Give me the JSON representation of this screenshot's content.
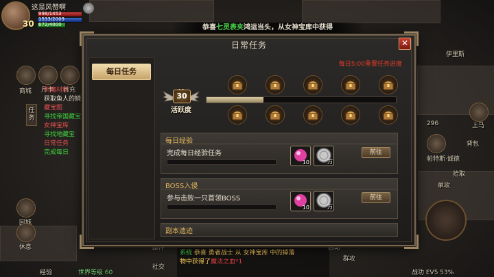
{
  "player": {
    "name": "这是风赞啊",
    "level": "30",
    "hp_text": "998/1453",
    "mp_text": "1533/2009",
    "xp_text": "672/4000"
  },
  "announcement": {
    "prefix": "恭喜",
    "highlight": "七灵表夹",
    "suffix": "鸿运当头，从女神宝库中获得"
  },
  "left_menu": {
    "items": [
      "商城",
      "月卡",
      "首充"
    ],
    "side_label": "任务",
    "bottom_items": [
      "回城",
      "休息"
    ]
  },
  "quest_tracker": [
    {
      "text": "附魔材料",
      "tone": "red"
    },
    {
      "text": "获取鱼人的鳞",
      "tone": "white"
    },
    {
      "text": "藏宝图",
      "tone": "red"
    },
    {
      "text": "寻找帝国藏宝",
      "tone": "green"
    },
    {
      "text": "女神宝库",
      "tone": "red"
    },
    {
      "text": "寻找地藏宝",
      "tone": "green"
    },
    {
      "text": "日常任务",
      "tone": "red"
    },
    {
      "text": "完成每日",
      "tone": "green"
    }
  ],
  "right_hud": {
    "location": "伊里斯",
    "coords": "296",
    "top_label": "上马",
    "right_labels": [
      "背包",
      "帕特斯·诚德",
      "拾取",
      "单攻"
    ]
  },
  "chat": {
    "lines": [
      {
        "prefix": "",
        "text": "中获得了",
        "item": "魔法之血*1"
      },
      {
        "prefix": "系统",
        "text": "恭喜 勇者战士 从 女神宝库 中的掉落",
        "item": ""
      },
      {
        "prefix": "",
        "text": "物中获得了",
        "item": "魔法之血*1"
      }
    ],
    "labels": [
      "邮件",
      "社交",
      "自动",
      "群攻"
    ]
  },
  "bottom_bar": {
    "exp_label": "经验",
    "extra": "世界等级 60",
    "combat_power": "战功 EV5 53%"
  },
  "dialog": {
    "title": "日常任务",
    "close_symbol": "✕",
    "tabs": [
      {
        "label": "每日任务",
        "selected": true
      }
    ],
    "reset_note": "每日5:00重置任务进度",
    "activity": {
      "value": "30",
      "label": "活跃度",
      "progress": 0.3
    },
    "tasks": [
      {
        "title": "每日经验",
        "description": "完成每日经验任务",
        "progress": 0,
        "rewards": [
          {
            "name": "magic-gem",
            "qty": "10"
          },
          {
            "name": "silver-coin",
            "qty": "万"
          }
        ],
        "button": "前往"
      },
      {
        "title": "BOSS入侵",
        "description": "参与击败一只首领BOSS",
        "progress": 0,
        "rewards": [
          {
            "name": "magic-gem",
            "qty": "10"
          },
          {
            "name": "silver-coin",
            "qty": "万"
          }
        ],
        "button": "前往"
      },
      {
        "title": "副本遗迹",
        "description": "",
        "progress": 0,
        "rewards": [],
        "button": ""
      }
    ],
    "chest_count": 10
  },
  "colors": {
    "accent_gold": "#e4b860",
    "reset_red": "#e03a2a",
    "tab_selected": "#c7a46a"
  }
}
